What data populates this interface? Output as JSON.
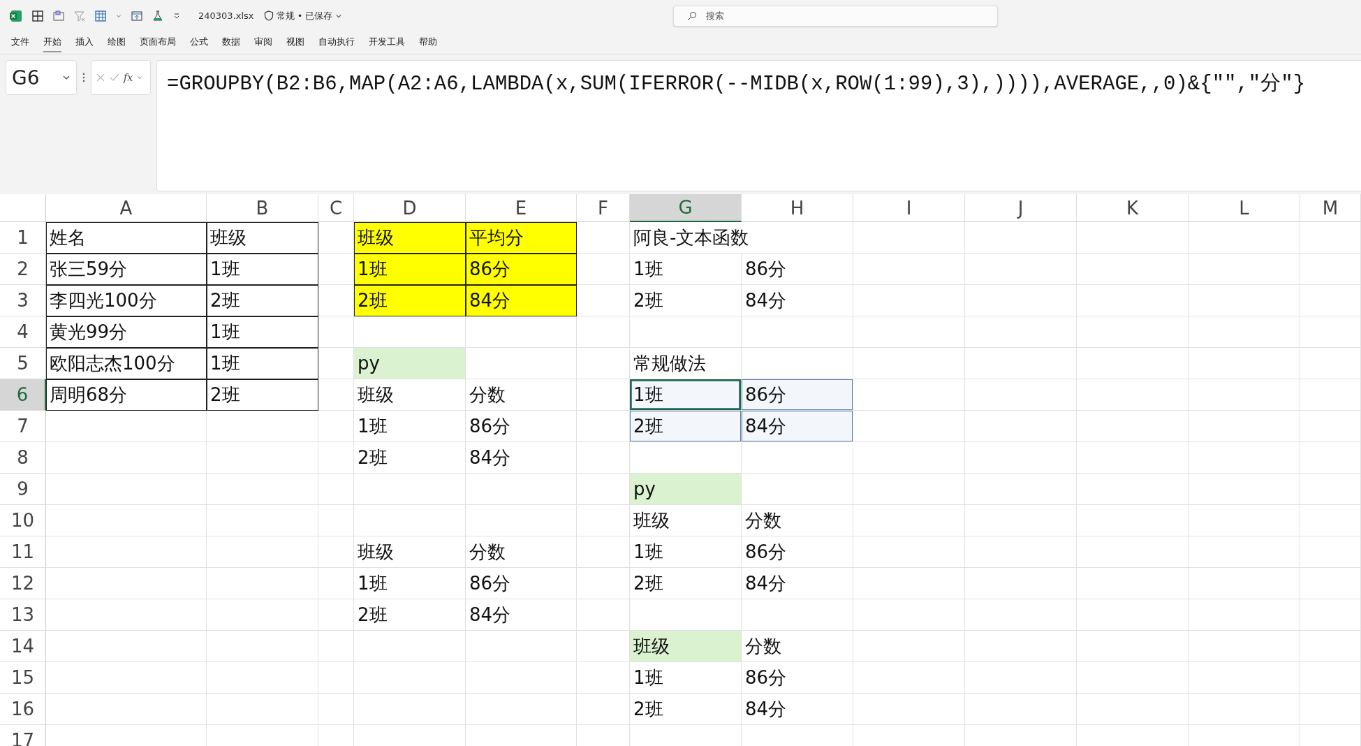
{
  "title_bar": {
    "file_name": "240303.xlsx",
    "status": "常规 • 已保存",
    "search": {
      "placeholder": "搜索"
    }
  },
  "ribbon_tabs": [
    {
      "label": "文件",
      "selected": false
    },
    {
      "label": "开始",
      "selected": true
    },
    {
      "label": "插入",
      "selected": false
    },
    {
      "label": "绘图",
      "selected": false
    },
    {
      "label": "页面布局",
      "selected": false
    },
    {
      "label": "公式",
      "selected": false
    },
    {
      "label": "数据",
      "selected": false
    },
    {
      "label": "审阅",
      "selected": false
    },
    {
      "label": "视图",
      "selected": false
    },
    {
      "label": "自动执行",
      "selected": false
    },
    {
      "label": "开发工具",
      "selected": false
    },
    {
      "label": "帮助",
      "selected": false
    }
  ],
  "formula_bar": {
    "name_box": "G6",
    "fx": "fx",
    "formula": "=GROUPBY(B2:B6,MAP(A2:A6,LAMBDA(x,SUM(IFERROR(--MIDB(x,ROW(1:99),3),)))),AVERAGE,,0)&{\"\",\"分\"}"
  },
  "columns": [
    {
      "label": "A",
      "selected": false
    },
    {
      "label": "B",
      "selected": false
    },
    {
      "label": "C",
      "selected": false
    },
    {
      "label": "D",
      "selected": false
    },
    {
      "label": "E",
      "selected": false
    },
    {
      "label": "F",
      "selected": false
    },
    {
      "label": "G",
      "selected": true
    },
    {
      "label": "H",
      "selected": false
    },
    {
      "label": "I",
      "selected": false
    },
    {
      "label": "J",
      "selected": false
    },
    {
      "label": "K",
      "selected": false
    },
    {
      "label": "L",
      "selected": false
    },
    {
      "label": "M",
      "selected": false
    }
  ],
  "rows": [
    {
      "label": "1",
      "selected": false,
      "cells": [
        {
          "text": "姓名",
          "bordered": true,
          "selected": false
        },
        {
          "text": "班级",
          "bordered": true,
          "selected": false
        },
        {
          "selected": false
        },
        {
          "text": "班级",
          "bordered": true,
          "color": "#ffff00",
          "selected": false
        },
        {
          "text": "平均分",
          "bordered": true,
          "color": "#ffff00",
          "selected": false
        },
        {
          "selected": false
        },
        {
          "text": "阿良-文本函数",
          "selected": false
        }
      ]
    },
    {
      "label": "2",
      "selected": false,
      "cells": [
        {
          "text": "张三59分",
          "bordered": true,
          "selected": false
        },
        {
          "text": "1班",
          "bordered": true,
          "selected": false
        },
        {
          "selected": false
        },
        {
          "text": "1班",
          "bordered": true,
          "color": "#ffff00",
          "selected": false
        },
        {
          "text": "86分",
          "bordered": true,
          "color": "#ffff00",
          "selected": false
        },
        {
          "selected": false
        },
        {
          "text": "1班",
          "selected": false
        },
        {
          "text": "86分",
          "selected": false
        }
      ]
    },
    {
      "label": "3",
      "selected": false,
      "cells": [
        {
          "text": "李四光100分",
          "bordered": true,
          "selected": false
        },
        {
          "text": "2班",
          "bordered": true,
          "selected": false
        },
        {
          "selected": false
        },
        {
          "text": "2班",
          "bordered": true,
          "color": "#ffff00",
          "selected": false
        },
        {
          "text": "84分",
          "bordered": true,
          "color": "#ffff00",
          "selected": false
        },
        {
          "selected": false
        },
        {
          "text": "2班",
          "selected": false
        },
        {
          "text": "84分",
          "selected": false
        }
      ]
    },
    {
      "label": "4",
      "selected": false,
      "cells": [
        {
          "text": "黄光99分",
          "bordered": true,
          "selected": false
        },
        {
          "text": "1班",
          "bordered": true,
          "selected": false
        },
        {
          "selected": false
        },
        {
          "selected": false
        },
        {
          "selected": false
        },
        {
          "selected": false
        },
        {
          "selected": false
        },
        {
          "selected": false
        }
      ]
    },
    {
      "label": "5",
      "selected": false,
      "cells": [
        {
          "text": "欧阳志杰100分",
          "bordered": true,
          "selected": false
        },
        {
          "text": "1班",
          "bordered": true,
          "selected": false
        },
        {
          "selected": false
        },
        {
          "text": "py",
          "color": "#daf2d0",
          "selected": false
        },
        {
          "selected": false
        },
        {
          "selected": false
        },
        {
          "text": "常规做法",
          "selected": false
        },
        {
          "selected": false
        }
      ]
    },
    {
      "label": "6",
      "selected": true,
      "cells": [
        {
          "text": "周明68分",
          "bordered": true,
          "selected": false
        },
        {
          "text": "2班",
          "bordered": true,
          "selected": false
        },
        {
          "selected": false
        },
        {
          "text": "班级",
          "selected": false
        },
        {
          "text": "分数",
          "selected": false
        },
        {
          "selected": false
        },
        {
          "text": "1班",
          "selected": true,
          "active": true
        },
        {
          "text": "86分",
          "selected": true
        }
      ]
    },
    {
      "label": "7",
      "selected": false,
      "cells": [
        {
          "selected": false
        },
        {
          "selected": false
        },
        {
          "selected": false
        },
        {
          "text": "1班",
          "selected": false
        },
        {
          "text": "86分",
          "selected": false
        },
        {
          "selected": false
        },
        {
          "text": "2班",
          "selected": true
        },
        {
          "text": "84分",
          "selected": true
        }
      ]
    },
    {
      "label": "8",
      "selected": false,
      "cells": [
        {
          "selected": false
        },
        {
          "selected": false
        },
        {
          "selected": false
        },
        {
          "text": "2班",
          "selected": false
        },
        {
          "text": "84分",
          "selected": false
        },
        {
          "selected": false
        },
        {
          "selected": false
        },
        {
          "selected": false
        }
      ]
    },
    {
      "label": "9",
      "selected": false,
      "cells": [
        {
          "selected": false
        },
        {
          "selected": false
        },
        {
          "selected": false
        },
        {
          "selected": false
        },
        {
          "selected": false
        },
        {
          "selected": false
        },
        {
          "text": "py",
          "color": "#daf2d0",
          "selected": false
        },
        {
          "selected": false
        }
      ]
    },
    {
      "label": "10",
      "selected": false,
      "cells": [
        {
          "selected": false
        },
        {
          "selected": false
        },
        {
          "selected": false
        },
        {
          "selected": false
        },
        {
          "selected": false
        },
        {
          "selected": false
        },
        {
          "text": "班级",
          "selected": false
        },
        {
          "text": "分数",
          "selected": false
        }
      ]
    },
    {
      "label": "11",
      "selected": false,
      "cells": [
        {
          "selected": false
        },
        {
          "selected": false
        },
        {
          "selected": false
        },
        {
          "text": "班级",
          "selected": false
        },
        {
          "text": "分数",
          "selected": false
        },
        {
          "selected": false
        },
        {
          "text": "1班",
          "selected": false
        },
        {
          "text": "86分",
          "selected": false
        }
      ]
    },
    {
      "label": "12",
      "selected": false,
      "cells": [
        {
          "selected": false
        },
        {
          "selected": false
        },
        {
          "selected": false
        },
        {
          "text": "1班",
          "selected": false
        },
        {
          "text": "86分",
          "selected": false
        },
        {
          "selected": false
        },
        {
          "text": "2班",
          "selected": false
        },
        {
          "text": "84分",
          "selected": false
        }
      ]
    },
    {
      "label": "13",
      "selected": false,
      "cells": [
        {
          "selected": false
        },
        {
          "selected": false
        },
        {
          "selected": false
        },
        {
          "text": "2班",
          "selected": false
        },
        {
          "text": "84分",
          "selected": false
        },
        {
          "selected": false
        },
        {
          "selected": false
        },
        {
          "selected": false
        }
      ]
    },
    {
      "label": "14",
      "selected": false,
      "cells": [
        {
          "selected": false
        },
        {
          "selected": false
        },
        {
          "selected": false
        },
        {
          "selected": false
        },
        {
          "selected": false
        },
        {
          "selected": false
        },
        {
          "text": "班级",
          "color": "#daf2d0",
          "selected": false
        },
        {
          "text": "分数",
          "selected": false
        }
      ]
    },
    {
      "label": "15",
      "selected": false,
      "cells": [
        {
          "selected": false
        },
        {
          "selected": false
        },
        {
          "selected": false
        },
        {
          "selected": false
        },
        {
          "selected": false
        },
        {
          "selected": false
        },
        {
          "text": "1班",
          "selected": false
        },
        {
          "text": "86分",
          "selected": false
        }
      ]
    },
    {
      "label": "16",
      "selected": false,
      "cells": [
        {
          "selected": false
        },
        {
          "selected": false
        },
        {
          "selected": false
        },
        {
          "selected": false
        },
        {
          "selected": false
        },
        {
          "selected": false
        },
        {
          "text": "2班",
          "selected": false
        },
        {
          "text": "84分",
          "selected": false
        }
      ]
    },
    {
      "label": "17",
      "selected": false,
      "cells": []
    }
  ]
}
